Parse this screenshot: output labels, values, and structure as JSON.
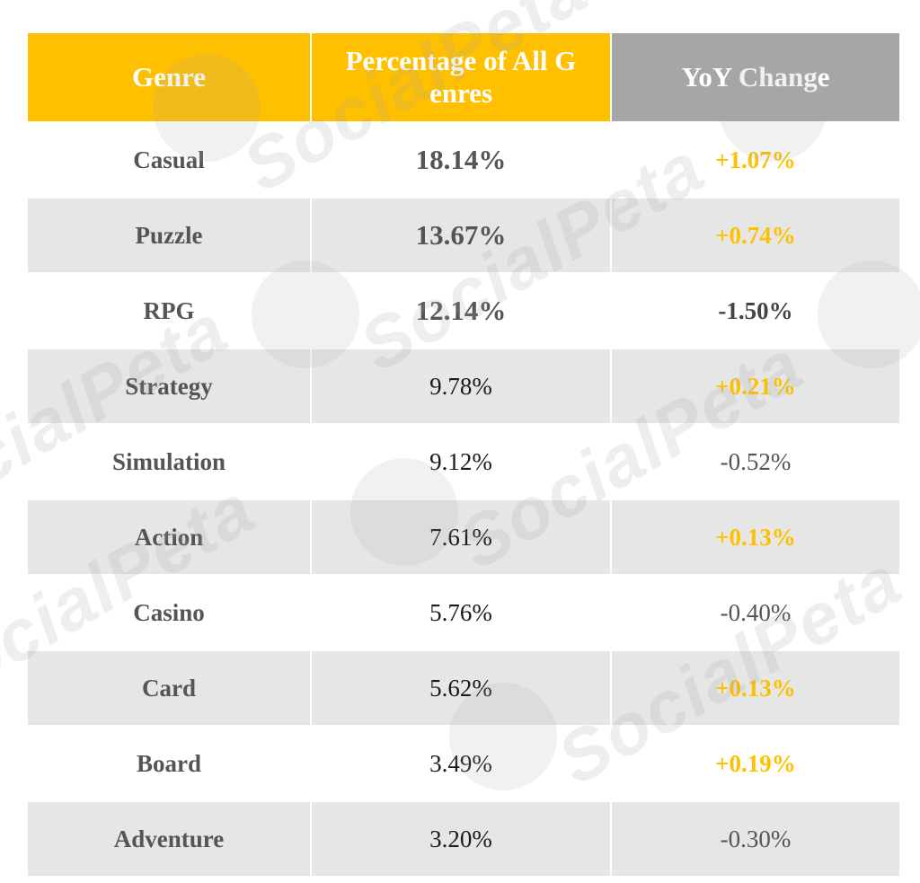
{
  "chart_data": {
    "type": "table",
    "title": "",
    "columns": [
      "Genre",
      "Percentage of All G enres",
      "YoY Change"
    ],
    "rows": [
      {
        "genre": "Casual",
        "percentage": "18.14%",
        "yoy": "+1.07%"
      },
      {
        "genre": "Puzzle",
        "percentage": "13.67%",
        "yoy": "+0.74%"
      },
      {
        "genre": "RPG",
        "percentage": "12.14%",
        "yoy": "-1.50%"
      },
      {
        "genre": "Strategy",
        "percentage": "9.78%",
        "yoy": "+0.21%"
      },
      {
        "genre": "Simulation",
        "percentage": "9.12%",
        "yoy": "-0.52%"
      },
      {
        "genre": "Action",
        "percentage": "7.61%",
        "yoy": "+0.13%"
      },
      {
        "genre": "Casino",
        "percentage": "5.76%",
        "yoy": "-0.40%"
      },
      {
        "genre": "Card",
        "percentage": "5.62%",
        "yoy": "+0.13%"
      },
      {
        "genre": "Board",
        "percentage": "3.49%",
        "yoy": "+0.19%"
      },
      {
        "genre": "Adventure",
        "percentage": "3.20%",
        "yoy": "-0.30%"
      }
    ],
    "values": {
      "percentage": [
        18.14,
        13.67,
        12.14,
        9.78,
        9.12,
        7.61,
        5.76,
        5.62,
        3.49,
        3.2
      ],
      "yoy_change": [
        1.07,
        0.74,
        -1.5,
        0.21,
        -0.52,
        0.13,
        -0.4,
        0.13,
        0.19,
        -0.3
      ]
    }
  },
  "colors": {
    "header_accent": "#ffc000",
    "header_gray": "#a6a6a6",
    "positive_change": "#ffc000",
    "negative_change": "#555555",
    "alt_row": "#e6e6e6"
  },
  "watermark": {
    "text": "SocialPeta"
  }
}
